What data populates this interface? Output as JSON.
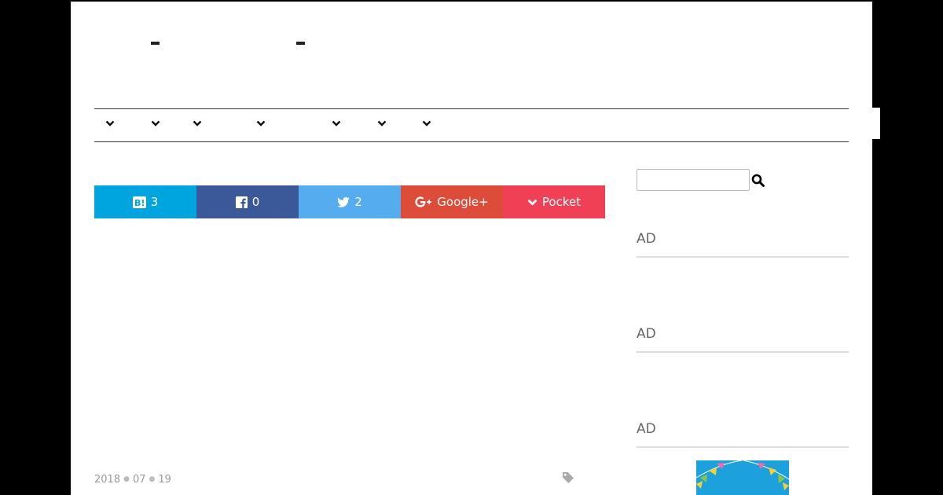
{
  "header": {
    "title_marks": [
      "-",
      "-"
    ]
  },
  "nav": {
    "items": [
      {
        "icon": "chevron-down-icon"
      },
      {
        "icon": "chevron-down-icon"
      },
      {
        "icon": "chevron-down-icon"
      },
      {
        "icon": "chevron-down-icon"
      },
      {
        "icon": "chevron-down-icon"
      },
      {
        "icon": "chevron-down-icon"
      },
      {
        "icon": "chevron-down-icon"
      }
    ]
  },
  "share": {
    "hatena": {
      "count": "3",
      "icon": "hatena-bookmark-icon",
      "color": "#00a4de"
    },
    "facebook": {
      "count": "0",
      "icon": "facebook-icon",
      "color": "#3b5998"
    },
    "twitter": {
      "count": "2",
      "icon": "twitter-icon",
      "color": "#55acee"
    },
    "googleplus": {
      "label": "Google+",
      "icon": "google-plus-icon",
      "color": "#dd4b39"
    },
    "pocket": {
      "label": "Pocket",
      "icon": "chevron-down-icon",
      "color": "#ef4056"
    }
  },
  "post": {
    "date_year": "2018",
    "date_month": "07",
    "date_day": "19",
    "tag_icon": "tag-icon"
  },
  "sidebar": {
    "search_value": "",
    "search_icon": "search-icon",
    "ads": [
      "AD",
      "AD",
      "AD"
    ],
    "banner_icon": "bunting-flags-image"
  }
}
